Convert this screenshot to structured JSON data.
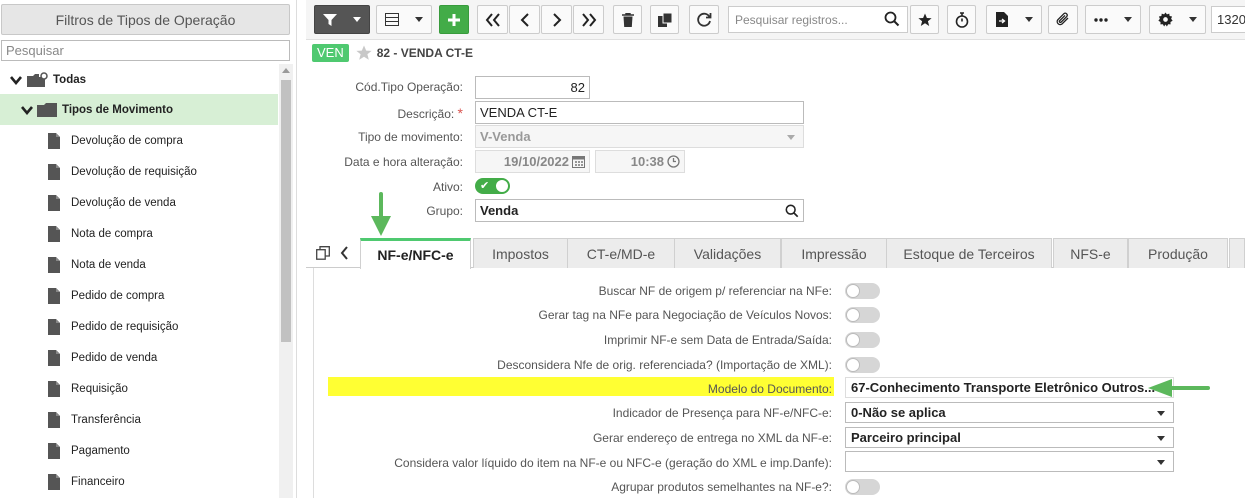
{
  "left_panel": {
    "header": "Filtros de Tipos de Operação",
    "search_placeholder": "Pesquisar",
    "root": "Todas",
    "group": "Tipos de Movimento",
    "items": [
      "Devolução de compra",
      "Devolução de requisição",
      "Devolução de venda",
      "Nota de compra",
      "Nota de venda",
      "Pedido de compra",
      "Pedido de requisição",
      "Pedido de venda",
      "Requisição",
      "Transferência",
      "Pagamento",
      "Financeiro"
    ]
  },
  "toolbar": {
    "search_placeholder": "Pesquisar registros...",
    "records_value": "1320"
  },
  "record": {
    "badge": "VEN",
    "title": "82 - VENDA CT-E"
  },
  "form": {
    "cod_label": "Cód.Tipo Operação:",
    "cod_value": "82",
    "desc_label": "Descrição:",
    "desc_required": "*",
    "desc_value": "VENDA CT-E",
    "tipo_label": "Tipo de movimento:",
    "tipo_value": "V-Venda",
    "data_label": "Data e hora alteração:",
    "date_value": "19/10/2022",
    "time_value": "10:38",
    "ativo_label": "Ativo:",
    "ativo_on": true,
    "grupo_label": "Grupo:",
    "grupo_value": "Venda"
  },
  "tabs": [
    "NF-e/NFC-e",
    "Impostos",
    "CT-e/MD-e",
    "Validações",
    "Impressão",
    "Estoque de Terceiros",
    "NFS-e",
    "Produção"
  ],
  "active_tab": "NF-e/NFC-e",
  "nfe": {
    "buscar_label": "Buscar NF de origem p/ referenciar na NFe:",
    "gerar_tag_label": "Gerar tag na NFe para Negociação de Veículos Novos:",
    "imprimir_label": "Imprimir NF-e sem Data de Entrada/Saída:",
    "desconsidera_label": "Desconsidera Nfe de orig. referenciada? (Importação de XML):",
    "modelo_label": "Modelo do Documento:",
    "modelo_value": "67-Conhecimento Transporte Eletrônico Outros...",
    "presenca_label": "Indicador de Presença para NF-e/NFC-e:",
    "presenca_value": "0-Não se aplica",
    "endereco_label": "Gerar endereço de entrega no XML da NF-e:",
    "endereco_value": "Parceiro principal",
    "considera_label": "Considera valor líquido do item na NF-e ou NFC-e (geração do XML e imp.Danfe):",
    "considera_value": "",
    "agrupar_label": "Agrupar produtos semelhantes na NF-e?:"
  },
  "colors": {
    "accent_green": "#43ac48",
    "badge_green": "#4fc970",
    "highlight": "#ffff33",
    "arrow_green": "#5cb85c"
  }
}
